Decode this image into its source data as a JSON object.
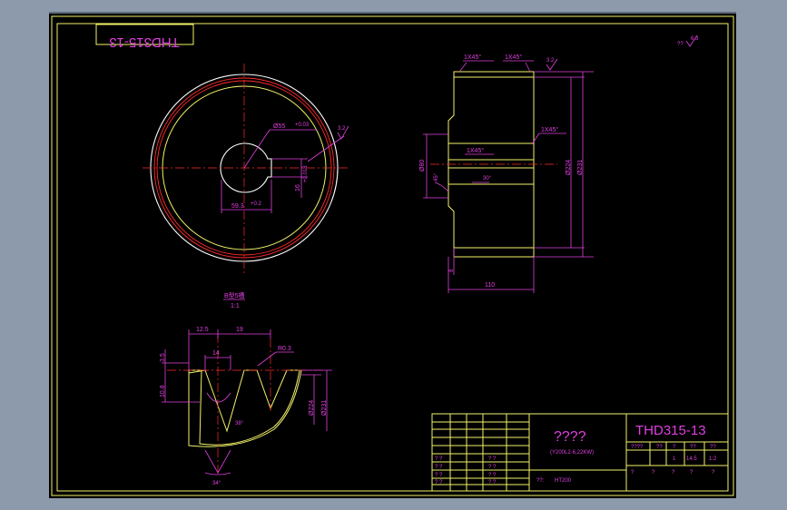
{
  "drawing": {
    "number": "THD315-13",
    "mirrored_number": "THD315-13",
    "roughness_corner": "??",
    "roughness_corner_value": "6.3"
  },
  "front_view": {
    "bore_dim": "Ø55",
    "bore_tol": "+0.03",
    "keyway_dim": "59.3",
    "keyway_tol": "+0.2",
    "key_width_dim": "16",
    "key_width_tol": "+0.018",
    "roughness": "3.2"
  },
  "section_view": {
    "chamfer_tl": "1X45°",
    "chamfer_tr": "1X45°",
    "chamfer_mid_r": "1X45°",
    "chamfer_mid_l": "1X45°",
    "dia_left": "Ø80",
    "dia_224": "Ø224",
    "dia_231": "Ø231",
    "angle": "45°",
    "angle_small": "30°",
    "width": "110",
    "small_dim": "8",
    "roughness": "3.2"
  },
  "groove_detail": {
    "title": "B型5槽",
    "scale": "1:1",
    "dim_125": "12.5",
    "dim_19": "19",
    "dim_14": "14",
    "dim_r03": "R0.3",
    "dim_35": "3.5",
    "dim_108": "10.8",
    "dim_224": "Ø224",
    "dim_231": "Ø231",
    "angle_38": "38°",
    "angle_34": "34°"
  },
  "title_block": {
    "name": "????",
    "subtitle": "(Y200L2-6,22KW)",
    "material_label": "??:",
    "material": "HT200",
    "drawing_no": "THD315-13",
    "row_labels": [
      "? ?",
      "? ?",
      "? ?",
      "? ?"
    ],
    "row_labels_mid": [
      "? ?",
      "? ?",
      "? ?",
      "? ?"
    ],
    "hdr_cells": [
      "????",
      "??",
      "?",
      "??",
      "??"
    ],
    "val_cells": [
      "",
      "",
      "1",
      "14.5",
      "1:2"
    ],
    "bottom_cells": [
      "?",
      "?",
      "?",
      "?",
      "?"
    ]
  }
}
